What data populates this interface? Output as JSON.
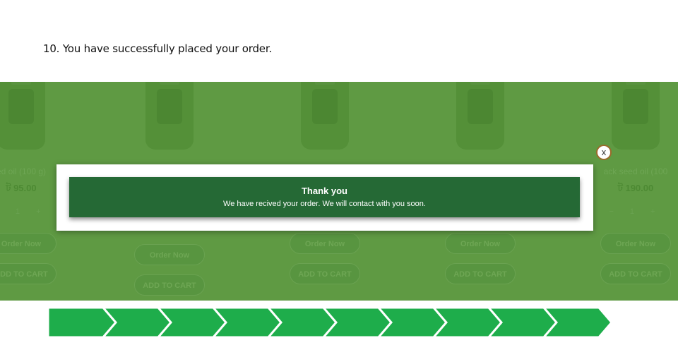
{
  "caption": "10. You have successfully placed your order.",
  "products": [
    {
      "name": "ed oil (100 g)",
      "price": "ট 95.00",
      "qty": "− 1 +",
      "btn1": "Order Now",
      "btn2": "ADD TO CART"
    },
    {
      "name": "",
      "price": "",
      "qty": "",
      "btn1": "Order Now",
      "btn2": "ADD TO CART"
    },
    {
      "name": "",
      "price": "",
      "qty": "",
      "btn1": "Order Now",
      "btn2": "ADD TO CART"
    },
    {
      "name": "",
      "price": "",
      "qty": "",
      "btn1": "Order Now",
      "btn2": "ADD TO CART"
    },
    {
      "name": "ack seed oil (100",
      "price": "ট 190.00",
      "qty": "− 1 +",
      "btn1": "Order Now",
      "btn2": "ADD TO CART"
    }
  ],
  "modal": {
    "title": "Thank you",
    "message": "We have recived your order. We will contact with you soon.",
    "close_label": "x"
  },
  "progress": {
    "steps_completed": 10,
    "steps_total": 10,
    "color": "#1ead4b"
  }
}
